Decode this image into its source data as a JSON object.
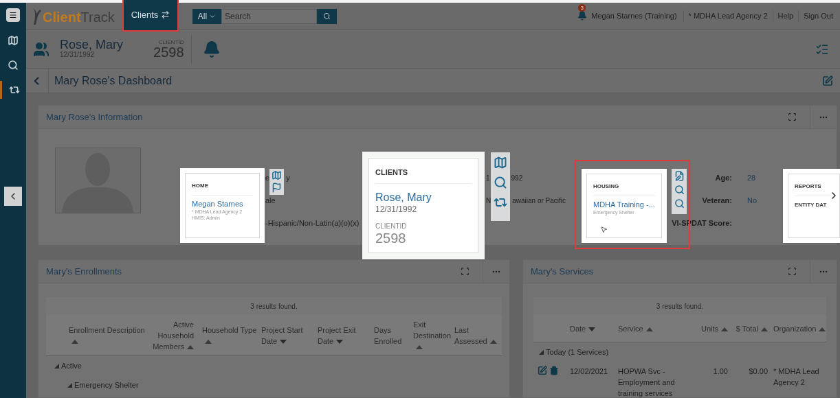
{
  "top_bar": {
    "logo": {
      "first": "Client",
      "second": "Track"
    },
    "module_button": {
      "label": "Clients",
      "highlighted": true
    },
    "search": {
      "scope": "All",
      "placeholder": "Search"
    },
    "notifications": {
      "count": "3"
    },
    "user": "Megan Starnes (Training)",
    "agency": "* MDHA Lead Agency 2",
    "links": [
      "Help",
      "Sign Out"
    ]
  },
  "sidebar": {
    "items": [
      {
        "kind": "map",
        "selected": false
      },
      {
        "kind": "search",
        "selected": false
      },
      {
        "kind": "switch",
        "selected": true
      }
    ]
  },
  "client_header": {
    "name": "Rose, Mary",
    "dob": "12/31/1992",
    "id_label": "CLIENTID",
    "id": "2598"
  },
  "page_title": "Mary Rose's Dashboard",
  "info_panel": {
    "title": "Mary Rose's Information",
    "rows_left": [
      {
        "parts": [
          "e",
          "y"
        ]
      },
      {
        "parts": [
          "ale"
        ]
      },
      {
        "parts": [
          "-Hispanic/Non-Latin(a)(o)(x)"
        ]
      }
    ],
    "rows_middle": [
      {
        "parts": [
          "1",
          "992"
        ]
      },
      {
        "parts": [
          "N",
          "awaiian or Pacific"
        ]
      }
    ],
    "fields": [
      {
        "label": "Age:",
        "value": "28"
      },
      {
        "label": "Veteran:",
        "value": "No"
      },
      {
        "label": "VI-SPDAT Score:"
      }
    ]
  },
  "enrollments": {
    "title": "Mary's Enrollments",
    "results": "3 results found.",
    "columns": [
      {
        "label": "Enrollment Description",
        "ascending": true
      },
      {
        "label": "Active Household Members",
        "ascending": true
      },
      {
        "label": "Household Type",
        "ascending": true
      },
      {
        "label": "Project Start Date",
        "ascending": false
      },
      {
        "label": "Project Exit Date",
        "ascending": false
      },
      {
        "label": "Days Enrolled"
      },
      {
        "label": "Exit Destination",
        "ascending": true
      },
      {
        "label": "Last Assessed",
        "ascending": true
      }
    ],
    "groups": [
      {
        "label": "Active",
        "expanded": true,
        "children": [
          {
            "label": "Emergency Shelter",
            "expanded": true
          }
        ]
      }
    ]
  },
  "services": {
    "title": "Mary's Services",
    "results": "3 results found.",
    "columns": [
      {
        "label": "Date",
        "ascending": false
      },
      {
        "label": "Service",
        "ascending": true
      },
      {
        "label": "Units",
        "ascending": true
      },
      {
        "label": "$ Total",
        "ascending": true
      },
      {
        "label": "Organization",
        "ascending": true
      }
    ],
    "groups": [
      {
        "label": "Today (1 Services)",
        "expanded": true,
        "rows": [
          {
            "date": "12/02/2021",
            "service": "HOPWA Svc - Employment and training services",
            "units": "1.00",
            "total": "$0.00",
            "organization": "* MDHA Lead Agency 2"
          }
        ]
      }
    ]
  },
  "quick_cards": [
    {
      "kind": "home",
      "heading": "HOME",
      "title": "Megan Starnes",
      "lines": [
        "* MDHA Lead Agency 2",
        "HMIS: Admin"
      ],
      "highlighted": false
    },
    {
      "kind": "clients",
      "heading": "CLIENTS",
      "title": "Rose, Mary",
      "lines": [
        "12/31/1992"
      ],
      "id_label": "CLIENTID",
      "id": "2598",
      "highlighted": false
    },
    {
      "kind": "housing",
      "heading": "HOUSING",
      "title": "MDHA Training -...",
      "lines": [
        "Emergency Shelter"
      ],
      "highlighted": true
    },
    {
      "kind": "reports",
      "heading": "REPORTS",
      "title": "ENTITY DAT",
      "highlighted": false
    }
  ]
}
